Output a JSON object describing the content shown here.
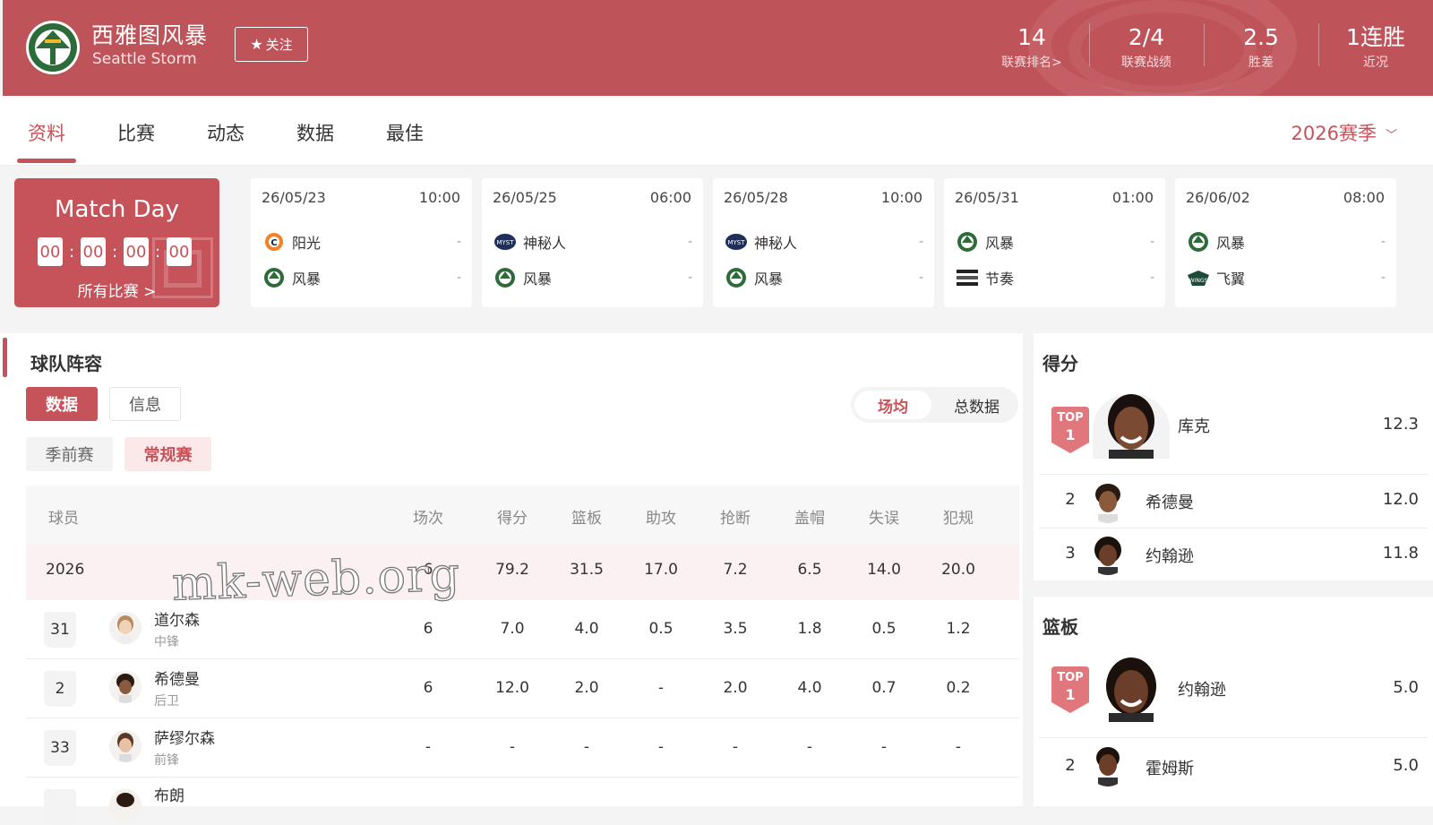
{
  "team": {
    "name_cn": "西雅图风暴",
    "name_en": "Seattle Storm",
    "follow_label": "关注"
  },
  "stats": [
    {
      "value": "14",
      "label": "联赛排名>"
    },
    {
      "value": "2/4",
      "label": "联赛战绩"
    },
    {
      "value": "2.5",
      "label": "胜差"
    },
    {
      "value": "1连胜",
      "label": "近况"
    }
  ],
  "tabs": [
    "资料",
    "比赛",
    "动态",
    "数据",
    "最佳"
  ],
  "season_label": "2026赛季",
  "matchday": {
    "title": "Match Day",
    "timer": [
      "00",
      "00",
      "00",
      "00"
    ],
    "all_games": "所有比赛 >"
  },
  "games": [
    {
      "date": "26/05/23",
      "time": "10:00",
      "home": "阳光",
      "home_score": "-",
      "away": "风暴",
      "away_score": "-"
    },
    {
      "date": "26/05/25",
      "time": "06:00",
      "home": "神秘人",
      "home_score": "-",
      "away": "风暴",
      "away_score": "-"
    },
    {
      "date": "26/05/28",
      "time": "10:00",
      "home": "神秘人",
      "home_score": "-",
      "away": "风暴",
      "away_score": "-"
    },
    {
      "date": "26/05/31",
      "time": "01:00",
      "home": "风暴",
      "home_score": "-",
      "away": "节奏",
      "away_score": "-"
    },
    {
      "date": "26/06/02",
      "time": "08:00",
      "home": "风暴",
      "home_score": "-",
      "away": "飞翼",
      "away_score": "-"
    }
  ],
  "roster": {
    "title": "球队阵容",
    "view_tabs": [
      "数据",
      "信息"
    ],
    "phase_tabs": [
      "季前赛",
      "常规赛"
    ],
    "mode_toggle": [
      "场均",
      "总数据"
    ],
    "columns": [
      "球员",
      "场次",
      "得分",
      "篮板",
      "助攻",
      "抢断",
      "盖帽",
      "失误",
      "犯规"
    ],
    "summary": {
      "label": "2026",
      "stats": [
        "6",
        "79.2",
        "31.5",
        "17.0",
        "7.2",
        "6.5",
        "14.0",
        "20.0"
      ]
    },
    "players": [
      {
        "number": "31",
        "name": "道尔森",
        "position": "中锋",
        "stats": [
          "6",
          "7.0",
          "4.0",
          "0.5",
          "3.5",
          "1.8",
          "0.5",
          "1.2"
        ]
      },
      {
        "number": "2",
        "name": "希德曼",
        "position": "后卫",
        "stats": [
          "6",
          "12.0",
          "2.0",
          "-",
          "2.0",
          "4.0",
          "0.7",
          "0.2"
        ]
      },
      {
        "number": "33",
        "name": "萨缪尔森",
        "position": "前锋",
        "stats": [
          "-",
          "-",
          "-",
          "-",
          "-",
          "-",
          "-",
          "-"
        ]
      },
      {
        "number": "",
        "name": "布朗",
        "position": "",
        "stats": []
      }
    ]
  },
  "watermark": "mk-web.org",
  "leaders": {
    "scoring": {
      "title": "得分",
      "top_label": "TOP",
      "top_rank": "1",
      "entries": [
        {
          "rank": "1",
          "name": "库克",
          "value": "12.3"
        },
        {
          "rank": "2",
          "name": "希德曼",
          "value": "12.0"
        },
        {
          "rank": "3",
          "name": "约翰逊",
          "value": "11.8"
        }
      ]
    },
    "rebounds": {
      "title": "篮板",
      "top_label": "TOP",
      "top_rank": "1",
      "entries": [
        {
          "rank": "1",
          "name": "约翰逊",
          "value": "5.0"
        },
        {
          "rank": "2",
          "name": "霍姆斯",
          "value": "5.0"
        }
      ]
    }
  },
  "colors": {
    "brand": "#c6535a",
    "header": "#bf535a",
    "storm_green": "#2e6b3a"
  }
}
